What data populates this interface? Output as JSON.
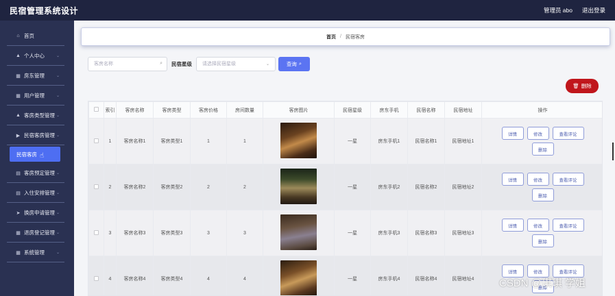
{
  "header": {
    "title": "民宿管理系统设计",
    "user_label": "管理员 abo",
    "logout": "退出登录"
  },
  "sidebar": {
    "items": [
      {
        "label": "首页",
        "icon": "home-icon",
        "glyph": "⌂",
        "chev": false
      },
      {
        "label": "个人中心",
        "icon": "user-icon",
        "glyph": "▲",
        "chev": true
      },
      {
        "label": "房东管理",
        "icon": "grid-icon",
        "glyph": "▦",
        "chev": true
      },
      {
        "label": "用户管理",
        "icon": "grid-icon",
        "glyph": "▦",
        "chev": true
      },
      {
        "label": "客房类型管理",
        "icon": "user-icon",
        "glyph": "▲",
        "chev": true
      },
      {
        "label": "民宿客房管理",
        "icon": "flag-icon",
        "glyph": "▶",
        "chev": true
      },
      {
        "label": "民宿客房",
        "sub": true
      },
      {
        "label": "客房预定管理",
        "icon": "doc-icon",
        "glyph": "▤",
        "chev": true
      },
      {
        "label": "入住安排管理",
        "icon": "doc-icon",
        "glyph": "▤",
        "chev": true
      },
      {
        "label": "换房申请管理",
        "icon": "send-icon",
        "glyph": "➤",
        "chev": true
      },
      {
        "label": "退房登记管理",
        "icon": "grid-icon",
        "glyph": "▦",
        "chev": true
      },
      {
        "label": "系统管理",
        "icon": "grid-icon",
        "glyph": "▦",
        "chev": true
      }
    ]
  },
  "breadcrumb": {
    "home": "首页",
    "sep": "/",
    "current": "民宿客房"
  },
  "search": {
    "name_placeholder": "客房名称",
    "star_label": "民宿星级",
    "star_placeholder": "请选择民宿星级",
    "query_label": "查询"
  },
  "delete_label": "删除",
  "table": {
    "headers": [
      "",
      "索引",
      "客房名称",
      "客房类型",
      "客房价格",
      "房间数量",
      "客房图片",
      "民宿星级",
      "房东手机",
      "民宿名称",
      "民宿地址",
      "操作"
    ],
    "rows": [
      {
        "index": "1",
        "name": "客房名称1",
        "type": "客房类型1",
        "price": "1",
        "count": "1",
        "star": "一星",
        "phone": "房东手机1",
        "inn": "民宿名称1",
        "addr": "民宿地址1"
      },
      {
        "index": "2",
        "name": "客房名称2",
        "type": "客房类型2",
        "price": "2",
        "count": "2",
        "star": "一星",
        "phone": "房东手机2",
        "inn": "民宿名称2",
        "addr": "民宿地址2"
      },
      {
        "index": "3",
        "name": "客房名称3",
        "type": "客房类型3",
        "price": "3",
        "count": "3",
        "star": "一星",
        "phone": "房东手机3",
        "inn": "民宿名称3",
        "addr": "民宿地址3"
      },
      {
        "index": "4",
        "name": "客房名称4",
        "type": "客房类型4",
        "price": "4",
        "count": "4",
        "star": "一星",
        "phone": "房东手机4",
        "inn": "民宿名称4",
        "addr": "民宿地址4"
      }
    ],
    "ops": {
      "detail": "详情",
      "edit": "修改",
      "review": "查看评论",
      "delete": "删除"
    }
  },
  "watermark": "CSDN @琪琪 学姐",
  "colors": {
    "topbar": "#1f2440",
    "sidebar": "#2a3152",
    "accent": "#4e6ef2",
    "danger": "#c0161c"
  }
}
